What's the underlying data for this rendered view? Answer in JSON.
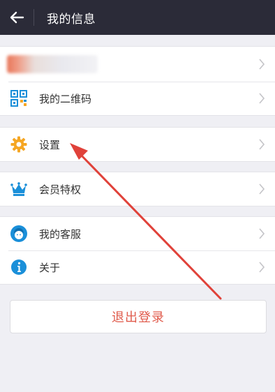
{
  "header": {
    "title": "我的信息"
  },
  "menu": {
    "qrcode_label": "我的二维码",
    "settings_label": "设置",
    "vip_label": "会员特权",
    "service_label": "我的客服",
    "about_label": "关于"
  },
  "logout_label": "退出登录",
  "colors": {
    "topbar": "#2b2b38",
    "accent_orange": "#f5a623",
    "accent_blue": "#1a8fd9",
    "logout_text": "#e05b4c",
    "annotation_arrow": "#e0423a"
  },
  "icons": {
    "back": "arrow-left-icon",
    "qrcode": "qrcode-icon",
    "settings": "gear-icon",
    "vip": "crown-icon",
    "service": "customer-service-icon",
    "about": "info-icon",
    "chevron": "chevron-right-icon"
  }
}
